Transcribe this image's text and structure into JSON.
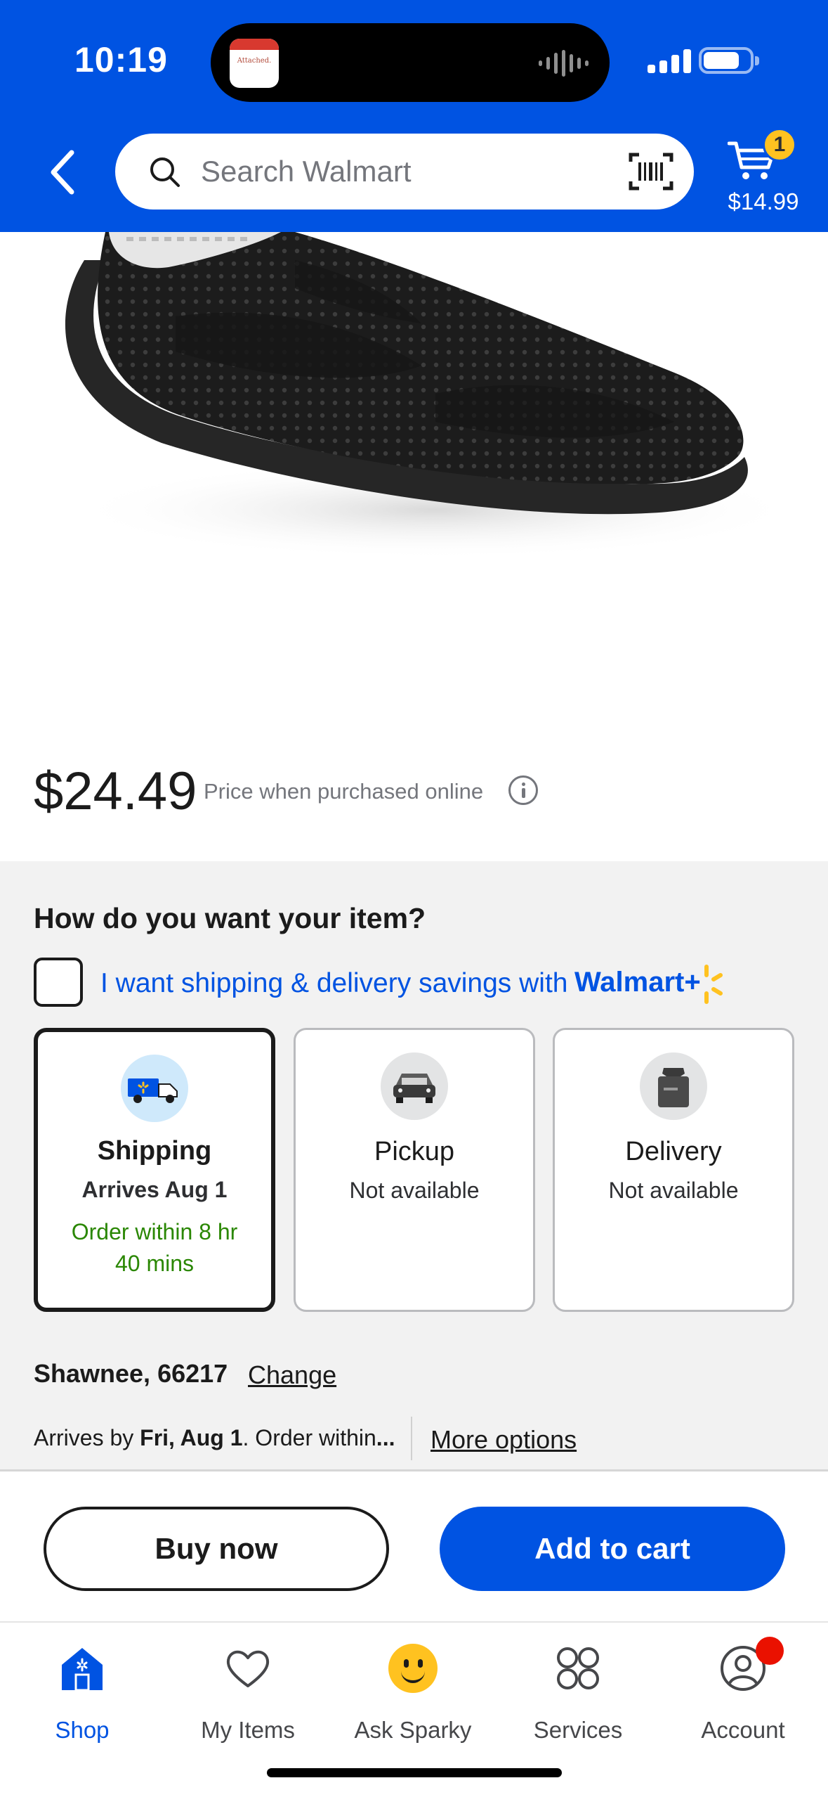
{
  "status_bar": {
    "time": "10:19",
    "island_app_text": "Attached."
  },
  "header": {
    "search_placeholder": "Search Walmart",
    "cart_count": "1",
    "cart_total": "$14.99",
    "brand_color": "#0053e2",
    "icons": [
      "back-arrow-icon",
      "search-icon",
      "barcode-scan-icon",
      "cart-icon"
    ]
  },
  "product": {
    "price": "$24.49",
    "price_note": "Price when purchased online"
  },
  "fulfillment": {
    "title": "How do you want your item?",
    "plus_text": "I want shipping & delivery savings with",
    "plus_brand": "Walmart+",
    "options": [
      {
        "label": "Shipping",
        "sub": "Arrives Aug 1",
        "note": "Order within 8 hr 40 mins",
        "selected": true,
        "icon": "shipping-truck-icon"
      },
      {
        "label": "Pickup",
        "sub": "Not available",
        "note": "",
        "selected": false,
        "icon": "pickup-car-icon"
      },
      {
        "label": "Delivery",
        "sub": "Not available",
        "note": "",
        "selected": false,
        "icon": "delivery-bag-icon"
      }
    ],
    "location": "Shawnee, 66217",
    "change_label": "Change",
    "arrives_prefix": "Arrives by ",
    "arrives_date": "Fri, Aug 1",
    "arrives_suffix": ". Order within",
    "arrives_ellipsis": "...",
    "more_options": "More options",
    "note_color": "#2a8703"
  },
  "actions": {
    "buy_now": "Buy now",
    "add_to_cart": "Add to cart"
  },
  "bottom_nav": [
    {
      "label": "Shop",
      "icon": "shop-icon",
      "active": true
    },
    {
      "label": "My Items",
      "icon": "heart-icon",
      "active": false
    },
    {
      "label": "Ask Sparky",
      "icon": "sparky-icon",
      "active": false
    },
    {
      "label": "Services",
      "icon": "services-grid-icon",
      "active": false
    },
    {
      "label": "Account",
      "icon": "account-icon",
      "active": false
    }
  ]
}
